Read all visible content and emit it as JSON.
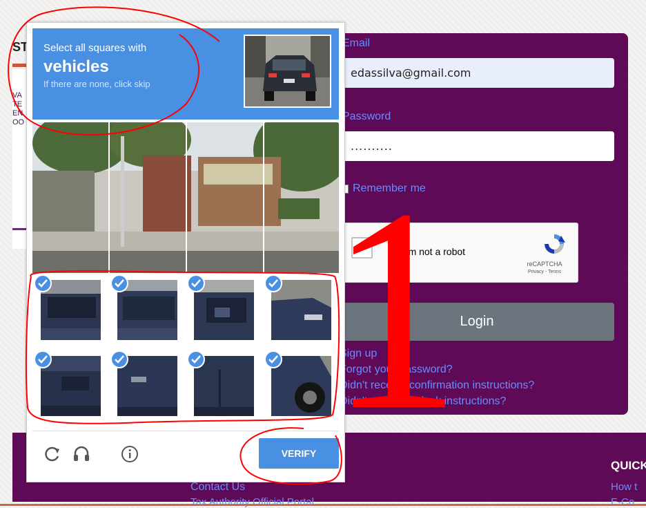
{
  "background_page": {
    "logo_fragment": "ST",
    "left_fragments": [
      "VA",
      "TE",
      "EN",
      "OO"
    ],
    "login": {
      "email_label": "Email",
      "email_value": "edassilva@gmail.com",
      "password_label": "Password",
      "password_value": "..........",
      "remember_label": "Remember me",
      "recaptcha_text": "I'm not a robot",
      "recaptcha_brand": "reCAPTCHA",
      "recaptcha_terms": "Privacy - Terms",
      "login_button": "Login",
      "links": [
        "Sign up",
        "Forgot your password?",
        "Didn't receive confirmation instructions?",
        "Didn't receive unlock instructions?"
      ]
    },
    "footer": {
      "contact": "Contact Us",
      "portal": "Tax Authority Official Portal",
      "quick_heading": "QUICK",
      "how_to": "How t",
      "e_com": "E-Co"
    }
  },
  "challenge": {
    "instruction_line1": "Select all squares with",
    "instruction_target": "vehicles",
    "instruction_line3": "If there are none, click skip",
    "verify_label": "VERIFY",
    "icons": [
      "reload-icon",
      "audio-icon",
      "info-icon"
    ],
    "grid_top_rows": 2,
    "grid_top_cols": 4,
    "grid_bottom_rows": 2,
    "grid_bottom_cols": 4,
    "selected_tiles": 8
  },
  "annotations": {
    "big_number": "1",
    "color": "#ff0000"
  },
  "colors": {
    "recaptcha_blue": "#4a90e2",
    "brand_purple": "#5e0a57",
    "link_blue": "#6b8cff"
  }
}
